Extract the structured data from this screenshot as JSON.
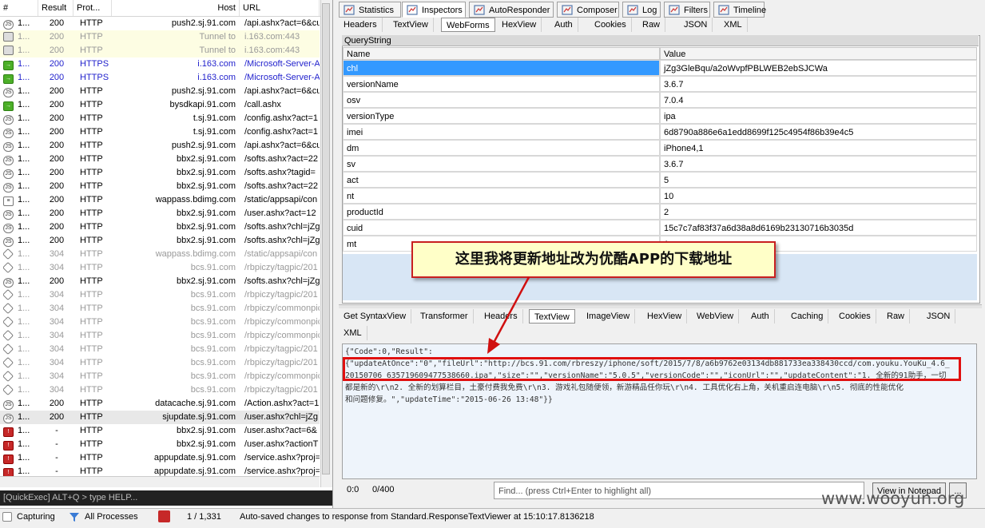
{
  "sessions": {
    "columns": {
      "num": "#",
      "result": "Result",
      "protocol": "Prot...",
      "host": "Host",
      "url": "URL"
    },
    "rows": [
      {
        "icon": "js",
        "num": "1...",
        "result": "200",
        "protocol": "HTTP",
        "host": "push2.sj.91.com",
        "url": "/api.ashx?act=6&cu",
        "style": ""
      },
      {
        "icon": "lock",
        "num": "1...",
        "result": "200",
        "protocol": "HTTP",
        "host": "Tunnel to",
        "url": "i.163.com:443",
        "style": "tunnel"
      },
      {
        "icon": "lock",
        "num": "1...",
        "result": "200",
        "protocol": "HTTP",
        "host": "Tunnel to",
        "url": "i.163.com:443",
        "style": "tunnel"
      },
      {
        "icon": "arrow",
        "num": "1...",
        "result": "200",
        "protocol": "HTTPS",
        "host": "i.163.com",
        "url": "/Microsoft-Server-A",
        "style": "https"
      },
      {
        "icon": "arrow",
        "num": "1...",
        "result": "200",
        "protocol": "HTTPS",
        "host": "i.163.com",
        "url": "/Microsoft-Server-A",
        "style": "https"
      },
      {
        "icon": "js",
        "num": "1...",
        "result": "200",
        "protocol": "HTTP",
        "host": "push2.sj.91.com",
        "url": "/api.ashx?act=6&cu",
        "style": ""
      },
      {
        "icon": "arrow",
        "num": "1...",
        "result": "200",
        "protocol": "HTTP",
        "host": "bysdkapi.91.com",
        "url": "/call.ashx",
        "style": ""
      },
      {
        "icon": "js",
        "num": "1...",
        "result": "200",
        "protocol": "HTTP",
        "host": "t.sj.91.com",
        "url": "/config.ashx?act=1",
        "style": ""
      },
      {
        "icon": "js",
        "num": "1...",
        "result": "200",
        "protocol": "HTTP",
        "host": "t.sj.91.com",
        "url": "/config.ashx?act=1",
        "style": ""
      },
      {
        "icon": "js",
        "num": "1...",
        "result": "200",
        "protocol": "HTTP",
        "host": "push2.sj.91.com",
        "url": "/api.ashx?act=6&cu",
        "style": ""
      },
      {
        "icon": "js",
        "num": "1...",
        "result": "200",
        "protocol": "HTTP",
        "host": "bbx2.sj.91.com",
        "url": "/softs.ashx?act=22",
        "style": ""
      },
      {
        "icon": "js",
        "num": "1...",
        "result": "200",
        "protocol": "HTTP",
        "host": "bbx2.sj.91.com",
        "url": "/softs.ashx?tagid=",
        "style": ""
      },
      {
        "icon": "js",
        "num": "1...",
        "result": "200",
        "protocol": "HTTP",
        "host": "bbx2.sj.91.com",
        "url": "/softs.ashx?act=22",
        "style": ""
      },
      {
        "icon": "doc",
        "num": "1...",
        "result": "200",
        "protocol": "HTTP",
        "host": "wappass.bdimg.com",
        "url": "/static/appsapi/con",
        "style": ""
      },
      {
        "icon": "js",
        "num": "1...",
        "result": "200",
        "protocol": "HTTP",
        "host": "bbx2.sj.91.com",
        "url": "/user.ashx?act=12",
        "style": ""
      },
      {
        "icon": "js",
        "num": "1...",
        "result": "200",
        "protocol": "HTTP",
        "host": "bbx2.sj.91.com",
        "url": "/softs.ashx?chl=jZg",
        "style": ""
      },
      {
        "icon": "js",
        "num": "1...",
        "result": "200",
        "protocol": "HTTP",
        "host": "bbx2.sj.91.com",
        "url": "/softs.ashx?chl=jZg",
        "style": ""
      },
      {
        "icon": "d304",
        "num": "1...",
        "result": "304",
        "protocol": "HTTP",
        "host": "wappass.bdimg.com",
        "url": "/static/appsapi/con",
        "style": "gray"
      },
      {
        "icon": "d304",
        "num": "1...",
        "result": "304",
        "protocol": "HTTP",
        "host": "bcs.91.com",
        "url": "/rbpiczy/tagpic/201",
        "style": "gray"
      },
      {
        "icon": "js",
        "num": "1...",
        "result": "200",
        "protocol": "HTTP",
        "host": "bbx2.sj.91.com",
        "url": "/softs.ashx?chl=jZg",
        "style": ""
      },
      {
        "icon": "d304",
        "num": "1...",
        "result": "304",
        "protocol": "HTTP",
        "host": "bcs.91.com",
        "url": "/rbpiczy/tagpic/201",
        "style": "gray"
      },
      {
        "icon": "d304",
        "num": "1...",
        "result": "304",
        "protocol": "HTTP",
        "host": "bcs.91.com",
        "url": "/rbpiczy/commonpic",
        "style": "gray"
      },
      {
        "icon": "d304",
        "num": "1...",
        "result": "304",
        "protocol": "HTTP",
        "host": "bcs.91.com",
        "url": "/rbpiczy/commonpic",
        "style": "gray"
      },
      {
        "icon": "d304",
        "num": "1...",
        "result": "304",
        "protocol": "HTTP",
        "host": "bcs.91.com",
        "url": "/rbpiczy/commonpic",
        "style": "gray"
      },
      {
        "icon": "d304",
        "num": "1...",
        "result": "304",
        "protocol": "HTTP",
        "host": "bcs.91.com",
        "url": "/rbpiczy/tagpic/201",
        "style": "gray"
      },
      {
        "icon": "d304",
        "num": "1...",
        "result": "304",
        "protocol": "HTTP",
        "host": "bcs.91.com",
        "url": "/rbpiczy/tagpic/201",
        "style": "gray"
      },
      {
        "icon": "d304",
        "num": "1...",
        "result": "304",
        "protocol": "HTTP",
        "host": "bcs.91.com",
        "url": "/rbpiczy/commonpic",
        "style": "gray"
      },
      {
        "icon": "d304",
        "num": "1...",
        "result": "304",
        "protocol": "HTTP",
        "host": "bcs.91.com",
        "url": "/rbpiczy/tagpic/201",
        "style": "gray"
      },
      {
        "icon": "js",
        "num": "1...",
        "result": "200",
        "protocol": "HTTP",
        "host": "datacache.sj.91.com",
        "url": "/Action.ashx?act=1",
        "style": ""
      },
      {
        "icon": "js",
        "num": "1...",
        "result": "200",
        "protocol": "HTTP",
        "host": "sjupdate.sj.91.com",
        "url": "/user.ashx?chl=jZg",
        "style": "sel"
      },
      {
        "icon": "err",
        "num": "1...",
        "result": "-",
        "protocol": "HTTP",
        "host": "bbx2.sj.91.com",
        "url": "/user.ashx?act=6&",
        "style": ""
      },
      {
        "icon": "err",
        "num": "1...",
        "result": "-",
        "protocol": "HTTP",
        "host": "bbx2.sj.91.com",
        "url": "/user.ashx?actionT",
        "style": ""
      },
      {
        "icon": "err",
        "num": "1...",
        "result": "-",
        "protocol": "HTTP",
        "host": "appupdate.sj.91.com",
        "url": "/service.ashx?proj=",
        "style": ""
      },
      {
        "icon": "err",
        "num": "1...",
        "result": "-",
        "protocol": "HTTP",
        "host": "appupdate.sj.91.com",
        "url": "/service.ashx?proj=",
        "style": ""
      }
    ]
  },
  "quickexec": {
    "placeholder": "[QuickExec] ALT+Q > type HELP..."
  },
  "top_tabs": [
    {
      "label": "Statistics",
      "icon": "stats-icon"
    },
    {
      "label": "Inspectors",
      "icon": "inspectors-icon"
    },
    {
      "label": "AutoResponder",
      "icon": "lightning-icon"
    },
    {
      "label": "Composer",
      "icon": "pencil-icon"
    },
    {
      "label": "Log",
      "icon": "log-icon"
    },
    {
      "label": "Filters",
      "icon": "checkbox-icon"
    },
    {
      "label": "Timeline",
      "icon": "timeline-icon"
    }
  ],
  "request_tabs": [
    "Headers",
    "TextView",
    "WebForms",
    "HexView",
    "Auth",
    "Cookies",
    "Raw",
    "JSON",
    "XML"
  ],
  "querystring": {
    "title": "QueryString",
    "col_name": "Name",
    "col_value": "Value",
    "rows": [
      {
        "name": "chl",
        "value": "jZg3GleBqu/a2oWvpfPBLWEB2ebSJCWa"
      },
      {
        "name": "versionName",
        "value": "3.6.7"
      },
      {
        "name": "osv",
        "value": "7.0.4"
      },
      {
        "name": "versionType",
        "value": "ipa"
      },
      {
        "name": "imei",
        "value": "6d8790a886e6a1edd8699f125c4954f86b39e4c5"
      },
      {
        "name": "dm",
        "value": "iPhone4,1"
      },
      {
        "name": "sv",
        "value": "3.6.7"
      },
      {
        "name": "act",
        "value": "5"
      },
      {
        "name": "nt",
        "value": "10"
      },
      {
        "name": "productId",
        "value": "2"
      },
      {
        "name": "cuid",
        "value": "15c7c7af83f37a6d38a8d6169b23130716b3035d"
      },
      {
        "name": "mt",
        "value": "1"
      }
    ]
  },
  "response_tabs": [
    "Get SyntaxView",
    "Transformer",
    "Headers",
    "TextView",
    "ImageView",
    "HexView",
    "WebView",
    "Auth",
    "Caching",
    "Cookies",
    "Raw",
    "JSON",
    "XML"
  ],
  "response_body": {
    "line1": "{\"Code\":0,\"Result\":",
    "line2": "{\"updateAtOnce\":\"0\",\"fileUrl\":\"http://bcs.91.com/rbreszy/iphone/soft/2015/7/8/a6b9762e03134db881733ea338430ccd/com.youku.YouKu_4.6_",
    "line3": "20150706_635719609477538660.ipa\",\"size\":\"\",\"versionName\":\"5.0.5\",\"versionCode\":\"\",\"iconUrl\":\"\",\"updateContent\":\"1. 全新的91助手，一切",
    "line4": "都是新的\\r\\n2. 全新的划算栏目，土豪付费我免费\\r\\n3. 游戏礼包随便领，新游精品任你玩\\r\\n4. 工具优化右上角，关机重启连电脑\\r\\n5. 彻底的性能优化",
    "line5": "和问题修复。\",\"updateTime\":\"2015-06-26 13:48\"}}"
  },
  "response_footer": {
    "pos": "0:0",
    "count": "0/400",
    "find_placeholder": "Find... (press Ctrl+Enter to highlight all)",
    "notepad_btn": "View in Notepad",
    "more_btn": "..."
  },
  "callout": {
    "text": "这里我将更新地址改为优酷APP的下载地址"
  },
  "status": {
    "capturing": "Capturing",
    "processes": "All Processes",
    "count": "1 / 1,331",
    "message": "Auto-saved changes to response from Standard.ResponseTextViewer at 15:10:17.8136218"
  },
  "watermark": "www.wooyun.org",
  "colors": {
    "selection": "#3399ff",
    "highlight_border": "#e01010",
    "callout_bg": "#ffffc8",
    "https_text": "#1f1fcc"
  }
}
